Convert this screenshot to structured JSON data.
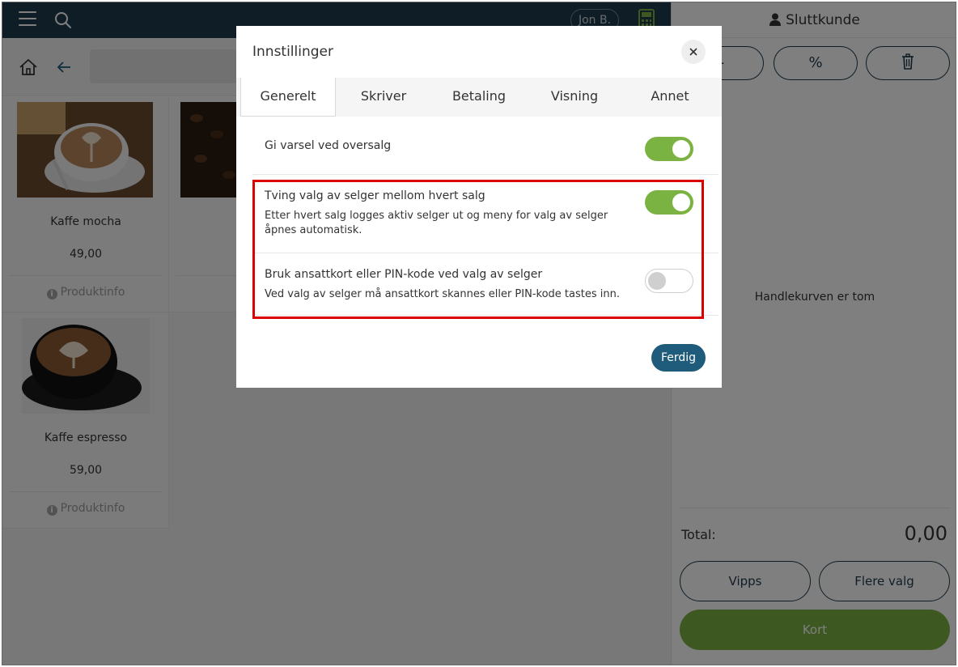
{
  "topbar": {
    "user_label": "Jon B."
  },
  "products": [
    {
      "name": "Kaffe mocha",
      "price": "49,00",
      "info_label": "Produktinfo"
    },
    {
      "name": "",
      "price": "",
      "info_label": "P"
    },
    {
      "name": "Kaffe espresso",
      "price": "59,00",
      "info_label": "Produktinfo"
    }
  ],
  "cart": {
    "customer_label": "Sluttkunde",
    "percent_glyph": "%",
    "minus_glyph": "-",
    "empty_text": "Handlekurven er tom",
    "total_label": "Total:",
    "total_value": "0,00",
    "pay_vipps": "Vipps",
    "pay_more": "Flere valg",
    "pay_card": "Kort"
  },
  "modal": {
    "title": "Innstillinger",
    "tabs": [
      {
        "label": "Generelt",
        "active": true
      },
      {
        "label": "Skriver"
      },
      {
        "label": "Betaling"
      },
      {
        "label": "Visning"
      },
      {
        "label": "Annet"
      }
    ],
    "settings": [
      {
        "title": "Gi varsel ved oversalg",
        "description": "",
        "enabled": true
      },
      {
        "title": "Tving valg av selger mellom hvert salg",
        "description": "Etter hvert salg logges aktiv selger ut og meny for valg av selger åpnes automatisk.",
        "enabled": true
      },
      {
        "title": "Bruk ansattkort eller PIN-kode ved valg av selger",
        "description": "Ved valg av selger må ansattkort skannes eller PIN-kode tastes inn.",
        "enabled": false
      }
    ],
    "done_label": "Ferdig"
  },
  "colors": {
    "header_bg": "#1f3b4d",
    "toggle_on": "#7bb342",
    "primary_button": "#1f5b7a",
    "highlight_border": "#d90000",
    "card_button": "#7bb342"
  }
}
